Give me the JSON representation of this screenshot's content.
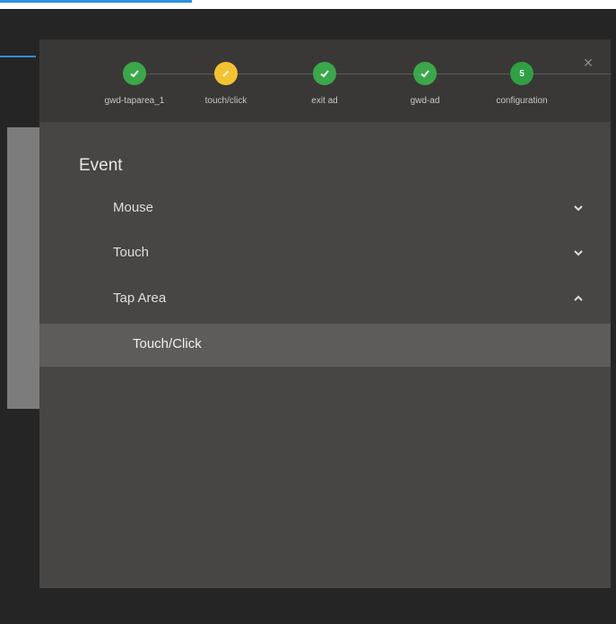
{
  "stepper": {
    "steps": [
      {
        "label": "gwd-taparea_1",
        "state": "done",
        "color": "#3aa84a"
      },
      {
        "label": "touch/click",
        "state": "current",
        "color": "#f3c233"
      },
      {
        "label": "exit ad",
        "state": "done",
        "color": "#3aa84a"
      },
      {
        "label": "gwd-ad",
        "state": "done",
        "color": "#3aa84a"
      },
      {
        "label": "configuration",
        "state": "numbered",
        "number": "5",
        "color": "#2fa043"
      }
    ]
  },
  "close_label": "×",
  "event": {
    "title": "Event",
    "items": [
      {
        "label": "Mouse",
        "icon": "chevron-down-icon"
      },
      {
        "label": "Touch",
        "icon": "chevron-down-icon"
      },
      {
        "label": "Tap Area",
        "icon": "chevron-up-icon"
      }
    ],
    "selected_item": "Touch/Click"
  }
}
